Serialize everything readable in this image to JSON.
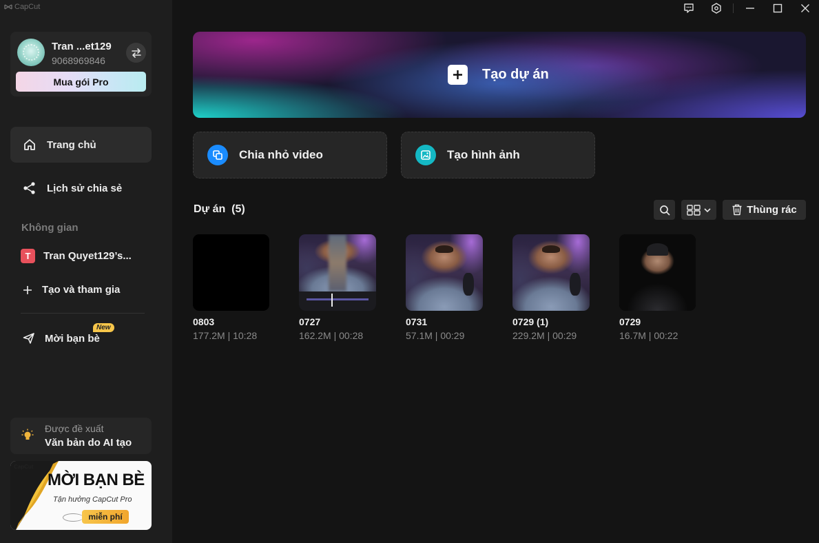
{
  "app": {
    "brand": "CapCut"
  },
  "user": {
    "name": "Tran ...et129",
    "phone": "9068969846",
    "pro_button": "Mua gói Pro"
  },
  "nav": {
    "home": "Trang chủ",
    "share_history": "Lịch sử chia sẻ",
    "space_label": "Không gian",
    "space_badge": "T",
    "space_name": "Tran Quyet129’s...",
    "create_join": "Tạo và tham gia",
    "invite": "Mời bạn bè",
    "new_badge": "New"
  },
  "suggestion": {
    "label": "Được đề xuất",
    "title": "Văn bản do AI tạo"
  },
  "promo": {
    "brand": "CapCut",
    "title": "MỜI BẠN BÈ",
    "subtitle": "Tận hưởng CapCut Pro",
    "tag": "miễn phí"
  },
  "main": {
    "create_project": "Tạo dự án",
    "split_video": "Chia nhỏ video",
    "create_image": "Tạo hình ảnh",
    "projects_title": "Dự án  (5)",
    "trash_label": "Thùng rác"
  },
  "projects": [
    {
      "name": "0803",
      "meta": "177.2M | 10:28"
    },
    {
      "name": "0727",
      "meta": "162.2M | 00:28"
    },
    {
      "name": "0731",
      "meta": "57.1M | 00:29"
    },
    {
      "name": "0729 (1)",
      "meta": "229.2M | 00:29"
    },
    {
      "name": "0729",
      "meta": "16.7M | 00:22"
    }
  ],
  "colors": {
    "accent_blue": "#1a8cff",
    "accent_teal": "#14b8c4",
    "space_badge": "#e8515c",
    "new_badge": "#f7c64a"
  }
}
